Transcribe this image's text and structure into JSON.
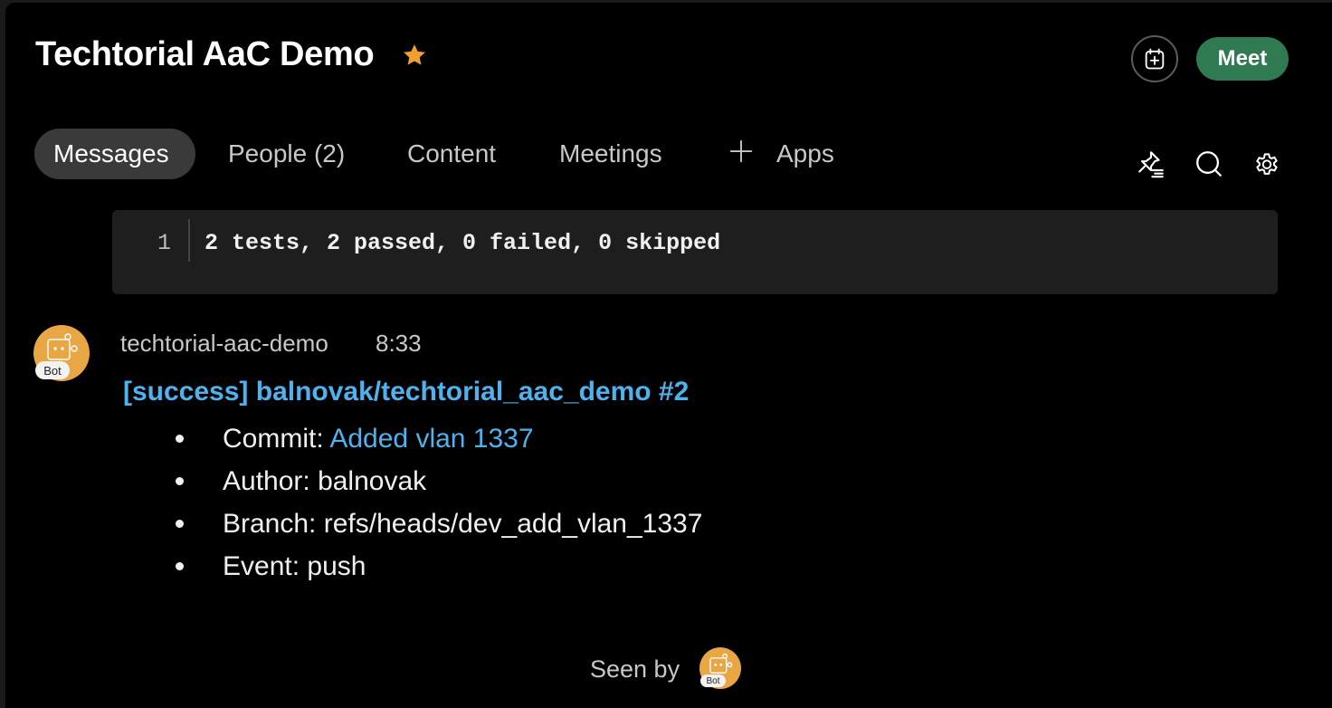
{
  "header": {
    "title": "Techtorial AaC Demo",
    "star_color": "#f0a030",
    "meet_label": "Meet",
    "meet_color": "#2f7a51",
    "calendar_icon": "calendar-add-icon"
  },
  "tabs": [
    {
      "label": "Messages",
      "active": true
    },
    {
      "label": "People (2)",
      "active": false
    },
    {
      "label": "Content",
      "active": false
    },
    {
      "label": "Meetings",
      "active": false
    },
    {
      "label": "Apps",
      "active": false,
      "icon": "plus-icon"
    }
  ],
  "toolbar": {
    "icons": [
      "pinned-messages-icon",
      "search-icon",
      "gear-icon"
    ]
  },
  "code_block": {
    "line_number": "1",
    "text": "2 tests, 2 passed, 0 failed, 0 skipped"
  },
  "message": {
    "sender": "techtorial-aac-demo",
    "time": "8:33",
    "badge": "Bot",
    "title": "[success] balnovak/techtorial_aac_demo #2",
    "items": [
      {
        "label": "Commit: ",
        "value": "Added vlan 1337",
        "is_link": true
      },
      {
        "label": "Author: ",
        "value": "balnovak",
        "is_link": false
      },
      {
        "label": "Branch: ",
        "value": "refs/heads/dev_add_vlan_1337",
        "is_link": false
      },
      {
        "label": "Event: ",
        "value": "push",
        "is_link": false
      }
    ],
    "link_color": "#4eb2ee"
  },
  "footer": {
    "seen_by": "Seen by",
    "badge": "Bot"
  }
}
